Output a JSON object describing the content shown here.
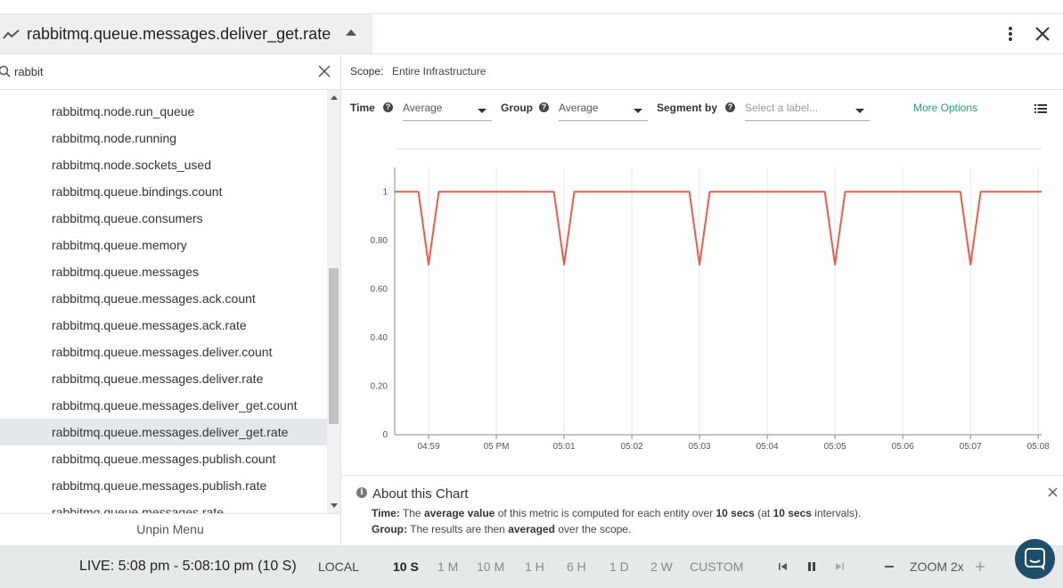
{
  "header": {
    "metric_title": "rabbitmq.queue.messages.deliver_get.rate",
    "icons": {
      "trend": "trend-line-icon",
      "collapse": "caret-up-icon",
      "more": "kebab-menu-icon",
      "close": "close-icon"
    }
  },
  "sidebar": {
    "search_value": "rabbit",
    "items": [
      {
        "label": "rabbitmq.node.run_queue"
      },
      {
        "label": "rabbitmq.node.running"
      },
      {
        "label": "rabbitmq.node.sockets_used"
      },
      {
        "label": "rabbitmq.queue.bindings.count"
      },
      {
        "label": "rabbitmq.queue.consumers"
      },
      {
        "label": "rabbitmq.queue.memory"
      },
      {
        "label": "rabbitmq.queue.messages"
      },
      {
        "label": "rabbitmq.queue.messages.ack.count"
      },
      {
        "label": "rabbitmq.queue.messages.ack.rate"
      },
      {
        "label": "rabbitmq.queue.messages.deliver.count"
      },
      {
        "label": "rabbitmq.queue.messages.deliver.rate"
      },
      {
        "label": "rabbitmq.queue.messages.deliver_get.count"
      },
      {
        "label": "rabbitmq.queue.messages.deliver_get.rate",
        "selected": true
      },
      {
        "label": "rabbitmq.queue.messages.publish.count"
      },
      {
        "label": "rabbitmq.queue.messages.publish.rate"
      },
      {
        "label": "rabbitmq.queue.messages.rate"
      }
    ],
    "unpin_label": "Unpin Menu"
  },
  "scope": {
    "label": "Scope:",
    "value": "Entire Infrastructure"
  },
  "controls": {
    "time_label": "Time",
    "time_value": "Average",
    "group_label": "Group",
    "group_value": "Average",
    "segment_label": "Segment by",
    "segment_placeholder": "Select a label...",
    "more_options": "More Options"
  },
  "chart_data": {
    "type": "line",
    "title": "",
    "xlabel": "",
    "ylabel": "",
    "x_ticks": [
      "04:59",
      "05 PM",
      "05:01",
      "05:02",
      "05:03",
      "05:04",
      "05:05",
      "05:06",
      "05:07",
      "05:08"
    ],
    "y_ticks": [
      "0",
      "0.20",
      "0.40",
      "0.60",
      "0.80",
      "1"
    ],
    "ylim": [
      0,
      1.1
    ],
    "xlim": [
      -0.5,
      9.05
    ],
    "grid": true,
    "series": [
      {
        "color": "#f05a4b",
        "points": [
          [
            -0.5,
            1
          ],
          [
            -0.15,
            1
          ],
          [
            0.0,
            0.7
          ],
          [
            0.15,
            1
          ],
          [
            1.85,
            1
          ],
          [
            2.0,
            0.7
          ],
          [
            2.15,
            1
          ],
          [
            3.85,
            1
          ],
          [
            4.0,
            0.7
          ],
          [
            4.15,
            1
          ],
          [
            5.85,
            1
          ],
          [
            6.0,
            0.7
          ],
          [
            6.15,
            1
          ],
          [
            7.85,
            1
          ],
          [
            8.0,
            0.7
          ],
          [
            8.15,
            1
          ],
          [
            9.05,
            1
          ]
        ]
      }
    ]
  },
  "about": {
    "heading": "About this Chart",
    "time_key": "Time:",
    "time_pre": "The",
    "time_bold1": "average value",
    "time_mid": "of this metric is computed for each entity over",
    "time_bold2": "10 secs",
    "time_mid2": "(at",
    "time_bold3": "10 secs",
    "time_end": "intervals).",
    "group_key": "Group:",
    "group_pre": "The results are then",
    "group_bold": "averaged",
    "group_end": "over the scope."
  },
  "footer": {
    "live_text": "LIVE: 5:08 pm - 5:08:10 pm (10 S)",
    "local_label": "LOCAL",
    "ranges": [
      "10 S",
      "1 M",
      "10 M",
      "1 H",
      "6 H",
      "1 D",
      "2 W",
      "CUSTOM"
    ],
    "active_range": "10 S",
    "zoom_label": "ZOOM 2x"
  }
}
